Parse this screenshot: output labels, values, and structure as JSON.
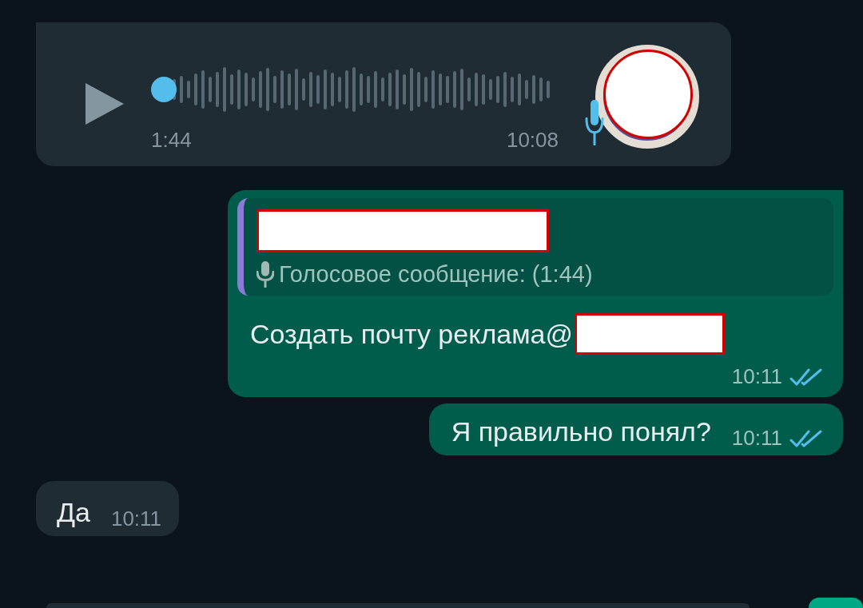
{
  "messages": [
    {
      "kind": "voice",
      "outgoing": false,
      "duration": "1:44",
      "time": "10:08"
    },
    {
      "kind": "reply",
      "outgoing": true,
      "quote": "Голосовое сообщение: (1:44)",
      "text": "Создать почту реклама@",
      "time": "10:11",
      "read": true
    },
    {
      "kind": "text",
      "outgoing": true,
      "text": "Я правильно понял?",
      "time": "10:11",
      "read": true
    },
    {
      "kind": "text",
      "outgoing": false,
      "text": "Да",
      "time": "10:11"
    }
  ]
}
